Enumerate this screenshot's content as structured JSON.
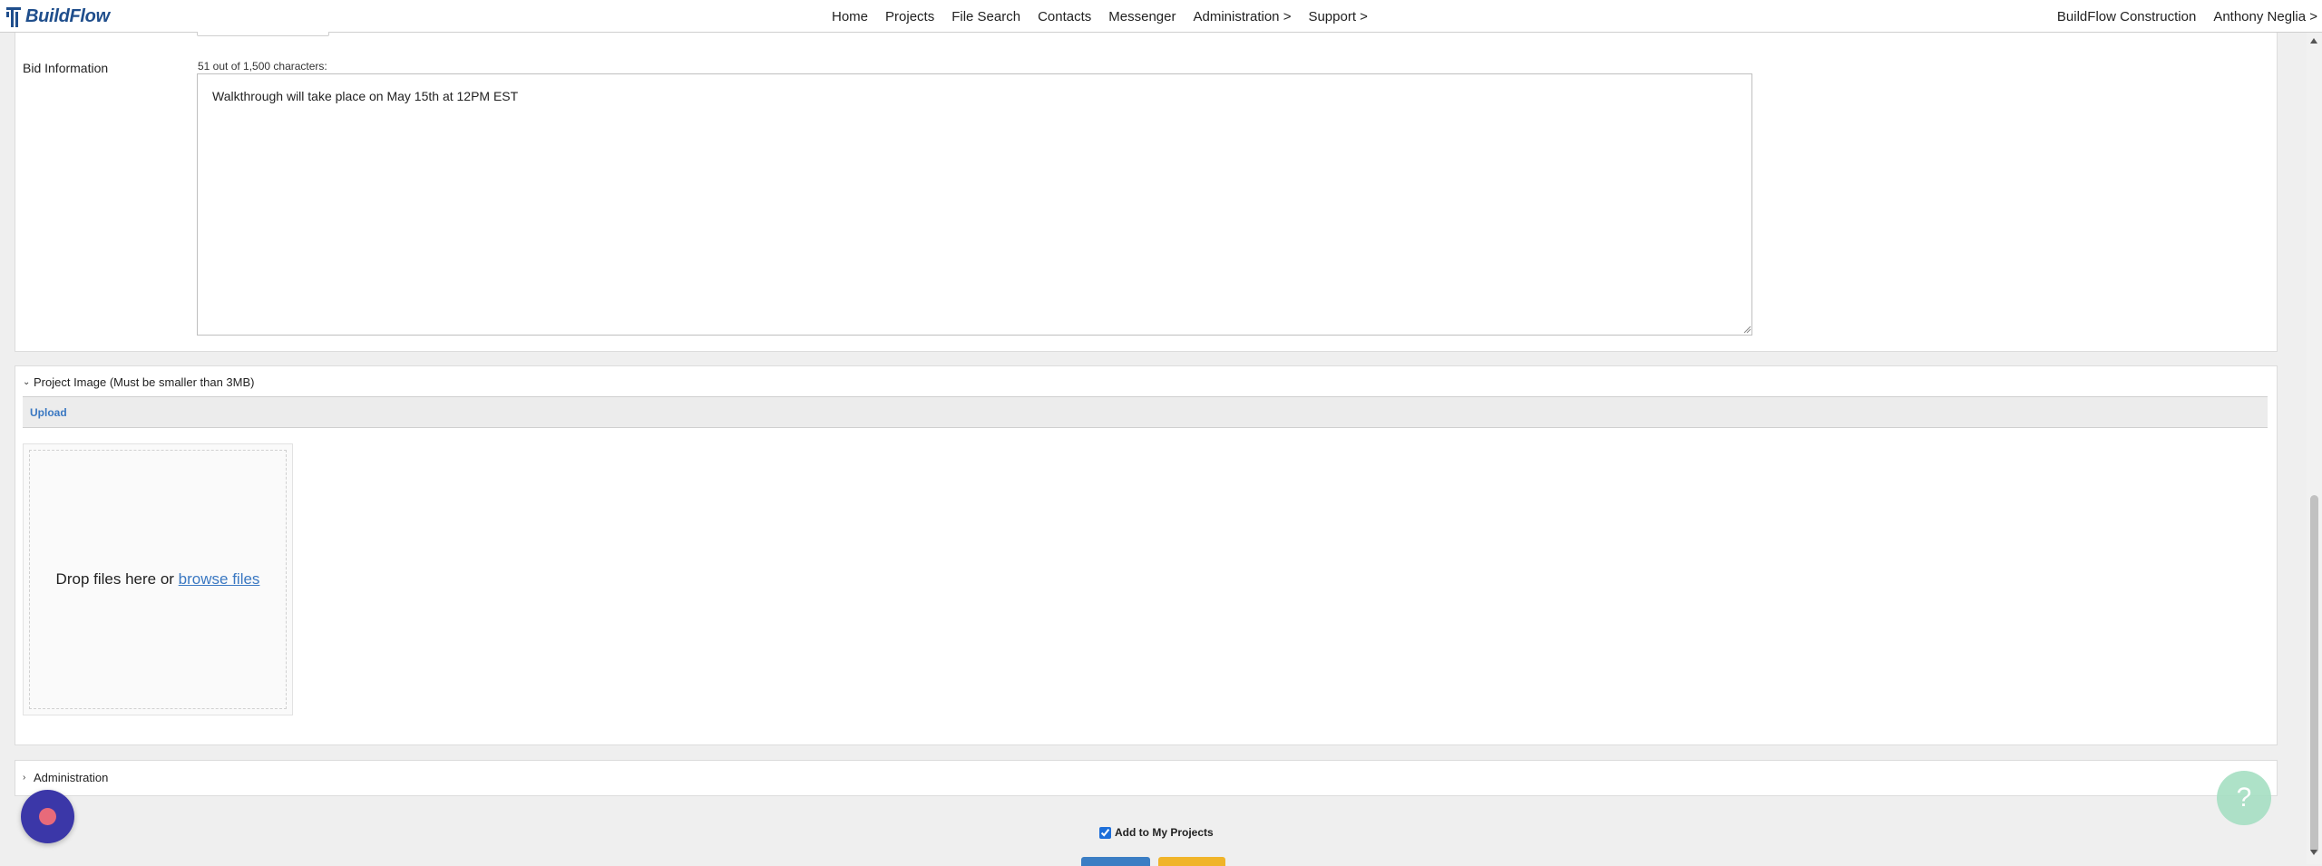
{
  "app": {
    "logo_text": "BuildFlow"
  },
  "nav": {
    "items": [
      {
        "label": "Home"
      },
      {
        "label": "Projects"
      },
      {
        "label": "File Search"
      },
      {
        "label": "Contacts"
      },
      {
        "label": "Messenger"
      },
      {
        "label": "Administration >"
      },
      {
        "label": "Support >"
      }
    ],
    "company": "BuildFlow Construction",
    "user": "Anthony Neglia >"
  },
  "bid_information": {
    "label": "Bid Information",
    "char_count": "51 out of 1,500 characters:",
    "value": "Walkthrough will take place on May 15th at 12PM EST"
  },
  "project_image": {
    "header": "Project Image (Must be smaller than 3MB)",
    "upload_label": "Upload",
    "drop_text": "Drop files here or",
    "browse_text": "browse files"
  },
  "administration": {
    "header": "Administration"
  },
  "add_to_my_projects": {
    "label": "Add to My Projects",
    "checked": true
  },
  "help": {
    "icon": "question-icon",
    "glyph": "?"
  },
  "colors": {
    "brand": "#1f4e8c",
    "link": "#3a78c2",
    "record": "#3b37a8",
    "help": "#a6dfc3"
  }
}
